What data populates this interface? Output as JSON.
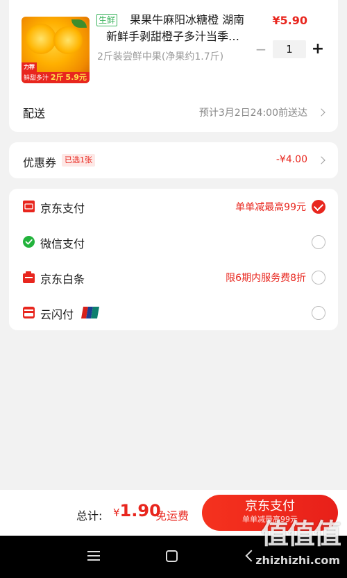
{
  "product": {
    "badge": "生鲜",
    "title_line1": "果果牛麻阳冰糖橙 湖南",
    "title_line2": "新鲜手剥甜橙子多汁当季…",
    "spec": "2斤装尝鲜中果(净果约1.7斤)",
    "price": "¥5.90",
    "quantity": "1",
    "minus": "−",
    "plus": "+",
    "image_promo_top": "力荐",
    "image_promo_label": "鲜甜多汁",
    "image_promo_weight": "2斤",
    "image_promo_price": "5.9元"
  },
  "delivery": {
    "label": "配送",
    "value": "预计3月2日24:00前送达"
  },
  "coupon": {
    "label": "优惠券",
    "chip": "已选1张",
    "value": "-¥4.00"
  },
  "payments": [
    {
      "name": "京东支付",
      "promo": "单单减最高99元",
      "icon": "jd-pay-icon",
      "selected": true
    },
    {
      "name": "微信支付",
      "promo": "",
      "icon": "wechat-pay-icon",
      "selected": false
    },
    {
      "name": "京东白条",
      "promo": "限6期内服务费8折",
      "icon": "jd-baitiao-icon",
      "selected": false
    },
    {
      "name": "云闪付",
      "promo": "",
      "icon": "unionpay-quickpass-icon",
      "selected": false
    }
  ],
  "checkout": {
    "total_label": "总计:",
    "currency": "¥",
    "amount": "1.90",
    "free_shipping": "免运费",
    "button_label": "京东支付",
    "button_sub": "单单减最高99元"
  },
  "watermark": {
    "text": "值值值",
    "site": "zhizhizhi.com"
  },
  "colors": {
    "accent": "#e8261e",
    "fresh_green": "#3bb35c",
    "background": "#f2f2f2"
  }
}
